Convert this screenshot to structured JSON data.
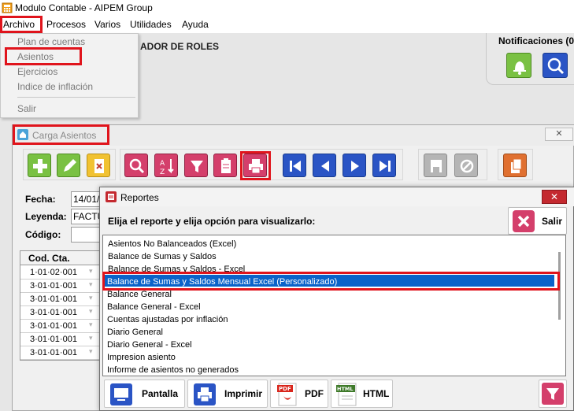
{
  "window": {
    "title": "Modulo Contable - AIPEM Group"
  },
  "menubar": {
    "items": [
      "Archivo",
      "Procesos",
      "Varios",
      "Utilidades",
      "Ayuda"
    ]
  },
  "archivo_menu": {
    "items": [
      "Plan de cuentas",
      "Asientos",
      "Ejercicios",
      "Indice de inflación"
    ],
    "exit": "Salir"
  },
  "background": {
    "roles_label": "ADOR DE ROLES",
    "notifications_title": "Notificaciones (0"
  },
  "carga": {
    "title": "Carga Asientos",
    "close_label": "✕",
    "fecha_label": "Fecha:",
    "fecha_value": "14/01/",
    "leyenda_label": "Leyenda:",
    "leyenda_value": "FACTU",
    "codigo_label": "Código:",
    "codigo_value": "",
    "grid_header": "Cod. Cta.",
    "grid_rows": [
      "1·01·02·001",
      "3·01·01·001",
      "3·01·01·001",
      "3·01·01·001",
      "3·01·01·001",
      "3·01·01·001",
      "3·01·01·001"
    ]
  },
  "reportes": {
    "title": "Reportes",
    "close_label": "✕",
    "prompt": "Elija el reporte y elija opción para visualizarlo:",
    "salir_label": "Salir",
    "items": [
      "Asientos No Balanceados (Excel)",
      "Balance de Sumas y Saldos",
      "Balance de Sumas y Saldos - Excel",
      "Balance de Sumas y Saldos Mensual Excel (Personalizado)",
      "Balance General",
      "Balance General - Excel",
      "Cuentas ajustadas por inflación",
      "Diario General",
      "Diario General - Excel",
      "Impresion asiento",
      "Informe de asientos no generados"
    ],
    "selected_index": 3,
    "buttons": {
      "pantalla": "Pantalla",
      "imprimir": "Imprimir",
      "pdf": "PDF",
      "html": "HTML"
    },
    "pdf_badge": "PDF",
    "html_badge": "HTML"
  },
  "colors": {
    "highlight": "#e0141c",
    "selection": "#0a63c9"
  }
}
